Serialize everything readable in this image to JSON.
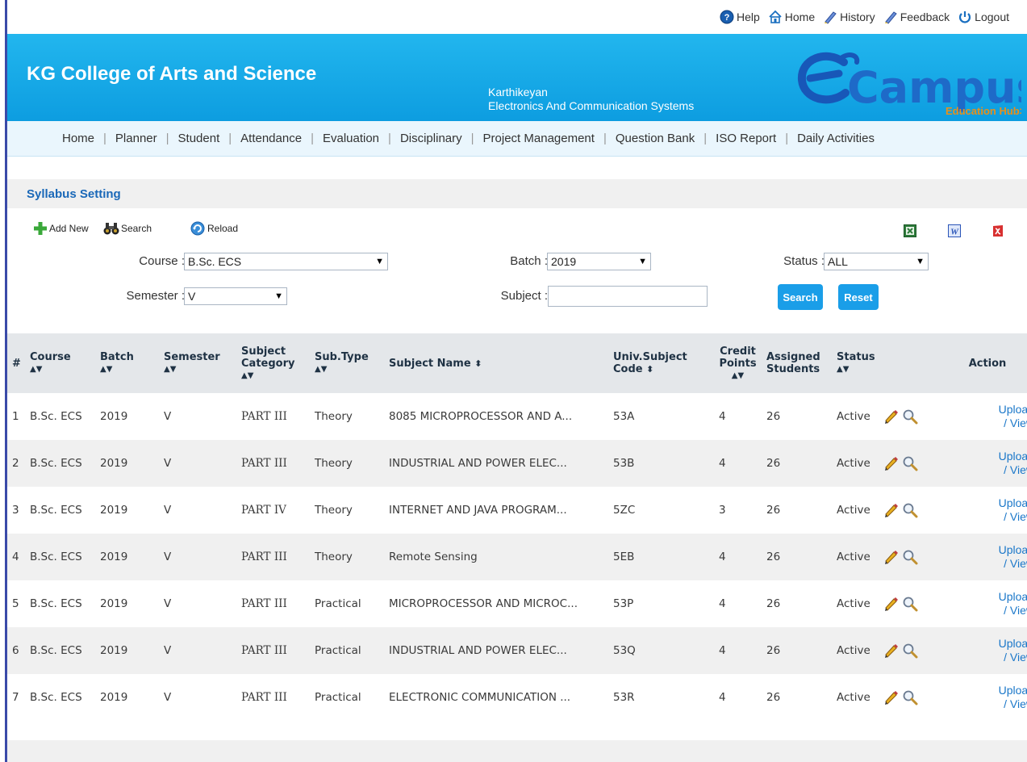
{
  "top_links": [
    {
      "label": "Help",
      "icon": "help-icon"
    },
    {
      "label": "Home",
      "icon": "home-icon"
    },
    {
      "label": "History",
      "icon": "history-icon"
    },
    {
      "label": "Feedback",
      "icon": "feedback-icon"
    },
    {
      "label": "Logout",
      "icon": "logout-icon"
    }
  ],
  "header": {
    "college": "KG College of Arts and Science",
    "user_name": "Karthikeyan",
    "department": "Electronics And Communication Systems",
    "logo_text": "Campus",
    "logo_tagline": "Education Hub>"
  },
  "nav": [
    "Home",
    "Planner",
    "Student",
    "Attendance",
    "Evaluation",
    "Disciplinary",
    "Project Management",
    "Question Bank",
    "ISO Report",
    "Daily Activities"
  ],
  "page_title": "Syllabus Setting",
  "toolbar": {
    "add_new": "Add New",
    "search": "Search",
    "reload": "Reload"
  },
  "filters": {
    "course_label": "Course :",
    "course_value": "B.Sc. ECS",
    "batch_label": "Batch :",
    "batch_value": "2019",
    "status_label": "Status :",
    "status_value": "ALL",
    "semester_label": "Semester :",
    "semester_value": "V",
    "subject_label": "Subject :",
    "subject_value": "",
    "search_button": "Search",
    "reset_button": "Reset"
  },
  "table": {
    "headers": {
      "num": "#",
      "course": "Course",
      "batch": "Batch",
      "semester": "Semester",
      "category_1": "Subject",
      "category_2": "Category",
      "subtype": "Sub.Type",
      "subject_name": "Subject Name",
      "code_1": "Univ.Subject",
      "code_2": "Code",
      "credit_1": "Credit",
      "credit_2": "Points",
      "assigned_1": "Assigned",
      "assigned_2": "Students",
      "status": "Status",
      "action": "Action"
    },
    "rows": [
      {
        "num": "1",
        "course": "B.Sc. ECS",
        "batch": "2019",
        "semester": "V",
        "category": "PART III",
        "subtype": "Theory",
        "name": "8085 MICROPROCESSOR AND A...",
        "code": "53A",
        "credit": "4",
        "assigned": "26",
        "status": "Active",
        "upload": "Upload",
        "view": "/ View"
      },
      {
        "num": "2",
        "course": "B.Sc. ECS",
        "batch": "2019",
        "semester": "V",
        "category": "PART III",
        "subtype": "Theory",
        "name": "INDUSTRIAL AND POWER ELEC...",
        "code": "53B",
        "credit": "4",
        "assigned": "26",
        "status": "Active",
        "upload": "Upload",
        "view": "/ View"
      },
      {
        "num": "3",
        "course": "B.Sc. ECS",
        "batch": "2019",
        "semester": "V",
        "category": "PART IV",
        "subtype": "Theory",
        "name": "INTERNET AND JAVA PROGRAM...",
        "code": "5ZC",
        "credit": "3",
        "assigned": "26",
        "status": "Active",
        "upload": "Upload",
        "view": "/ View"
      },
      {
        "num": "4",
        "course": "B.Sc. ECS",
        "batch": "2019",
        "semester": "V",
        "category": "PART III",
        "subtype": "Theory",
        "name": "Remote Sensing",
        "code": "5EB",
        "credit": "4",
        "assigned": "26",
        "status": "Active",
        "upload": "Upload",
        "view": "/ View"
      },
      {
        "num": "5",
        "course": "B.Sc. ECS",
        "batch": "2019",
        "semester": "V",
        "category": "PART III",
        "subtype": "Practical",
        "name": "MICROPROCESSOR AND MICROC...",
        "code": "53P",
        "credit": "4",
        "assigned": "26",
        "status": "Active",
        "upload": "Upload",
        "view": "/ View"
      },
      {
        "num": "6",
        "course": "B.Sc. ECS",
        "batch": "2019",
        "semester": "V",
        "category": "PART III",
        "subtype": "Practical",
        "name": "INDUSTRIAL AND POWER ELEC...",
        "code": "53Q",
        "credit": "4",
        "assigned": "26",
        "status": "Active",
        "upload": "Upload",
        "view": "/ View"
      },
      {
        "num": "7",
        "course": "B.Sc. ECS",
        "batch": "2019",
        "semester": "V",
        "category": "PART III",
        "subtype": "Practical",
        "name": "ELECTRONIC COMMUNICATION ...",
        "code": "53R",
        "credit": "4",
        "assigned": "26",
        "status": "Active",
        "upload": "Upload",
        "view": "/ View"
      }
    ]
  },
  "colors": {
    "header_blue": "#1aa8ea",
    "link_blue": "#1a77c9",
    "title_blue": "#1a68b8",
    "button_blue": "#1a9ee8"
  }
}
